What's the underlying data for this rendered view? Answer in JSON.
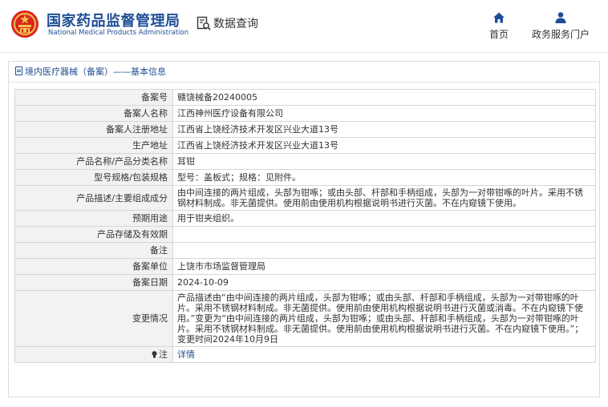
{
  "header": {
    "brand_cn": "国家药品监督管理局",
    "brand_en": "National Medical Products Administration",
    "query_label": "数据查询",
    "nav": {
      "home_label": "首页",
      "portal_label": "政务服务门户"
    }
  },
  "breadcrumb": "境内医疗器械（备案）——基本信息",
  "colors": {
    "brand_blue": "#1f4e96",
    "emblem_red": "#d8261e",
    "emblem_gold": "#f2c14e",
    "label_bg": "#f2f2f2"
  },
  "rows": [
    {
      "label": "备案号",
      "value": "赣饶械备20240005"
    },
    {
      "label": "备案人名称",
      "value": "江西神州医疗设备有限公司"
    },
    {
      "label": "备案人注册地址",
      "value": "江西省上饶经济技术开发区兴业大道13号"
    },
    {
      "label": "生产地址",
      "value": "江西省上饶经济技术开发区兴业大道13号"
    },
    {
      "label": "产品名称/产品分类名称",
      "value": "耳钳"
    },
    {
      "label": "型号规格/包装规格",
      "value": "型号：盖板式；规格：见附件。"
    },
    {
      "label": "产品描述/主要组成成分",
      "value": "由中间连接的两片组成，头部为钳啄；或由头部、杆部和手柄组成，头部为一对带钳啄的叶片。采用不锈钢材料制成。非无菌提供。使用前由使用机构根据说明书进行灭菌。不在内窥镜下使用。"
    },
    {
      "label": "预期用途",
      "value": "用于钳夹组织。"
    },
    {
      "label": "产品存储及有效期",
      "value": ""
    },
    {
      "label": "备注",
      "value": ""
    },
    {
      "label": "备案单位",
      "value": "上饶市市场监督管理局"
    },
    {
      "label": "备案日期",
      "value": "2024-10-09"
    },
    {
      "label": "变更情况",
      "value": "产品描述由“由中间连接的两片组成，头部为钳啄；或由头部、杆部和手柄组成，头部为一对带钳啄的叶片。采用不锈钢材料制成。非无菌提供。使用前由使用机构根据说明书进行灭菌或消毒。不在内窥镜下使用。”变更为“由中间连接的两片组成，头部为钳啄；或由头部、杆部和手柄组成，头部为一对带钳啄的叶片。采用不锈钢材料制成。非无菌提供。使用前由使用机构根据说明书进行灭菌。不在内窥镜下使用。”；变更时间2024年10月9日"
    },
    {
      "label": "注",
      "value": "详情"
    }
  ]
}
